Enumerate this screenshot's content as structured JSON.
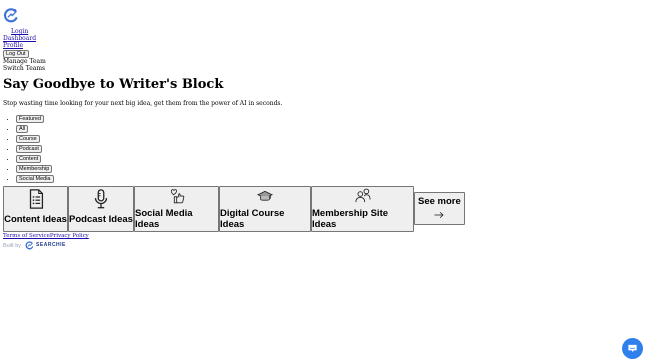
{
  "nav": {
    "login": "Login",
    "dashboard": "Dashboard",
    "profile": "Profile",
    "logout": "Log Out",
    "manage_team": "Manage Team",
    "switch_teams": "Switch Teams"
  },
  "hero": {
    "title": "Say Goodbye to Writer's Block",
    "subtitle": "Stop wasting time looking for your next big idea, get them from the power of AI in seconds."
  },
  "filters": [
    "Featured",
    "All",
    "Course",
    "Podcast",
    "Content",
    "Membership",
    "Social Media"
  ],
  "cards": [
    {
      "label": "Content Ideas",
      "icon": "document-list-icon"
    },
    {
      "label": "Podcast Ideas",
      "icon": "microphone-icon"
    },
    {
      "label": "Social Media Ideas",
      "icon": "heart-thumbs-up-icon"
    },
    {
      "label": "Digital Course Ideas",
      "icon": "graduation-cap-icon"
    },
    {
      "label": "Membership Site Ideas",
      "icon": "users-icon"
    }
  ],
  "see_more": {
    "label": "See more",
    "icon": "arrow-right-icon"
  },
  "footer": {
    "terms": "Terms of Service",
    "privacy": "Privacy Policy",
    "built_by": "Built by",
    "brand": "SEARCHIE"
  },
  "colors": {
    "link": "#1a0dab",
    "chat": "#2f80ed",
    "logo": "#3b6ed6",
    "brand": "#1e3a8a"
  }
}
